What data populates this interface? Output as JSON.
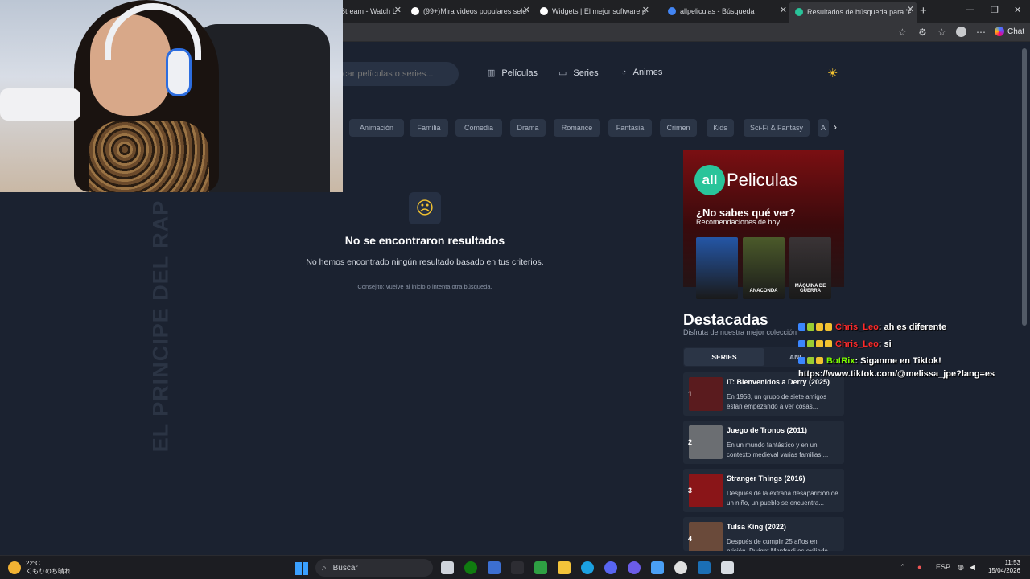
{
  "browser": {
    "tabs": [
      {
        "title": "Stream - Watch L",
        "favicon_color": "#9146ff",
        "active": false
      },
      {
        "title": "(99+)Mira videos populares selecc",
        "favicon_color": "#ffffff",
        "active": false
      },
      {
        "title": "Widgets | El mejor software para g",
        "favicon_color": "#ffffff",
        "active": false
      },
      {
        "title": "allpeliculas - Búsqueda",
        "favicon_color": "#4285f4",
        "active": false
      },
      {
        "title": "Resultados de búsqueda para \"el p",
        "favicon_color": "#29c49a",
        "active": true
      }
    ],
    "chat_label": "Chat"
  },
  "header": {
    "search_placeholder": "car películas o series...",
    "nav": [
      {
        "label": "Películas",
        "icon": "film-icon"
      },
      {
        "label": "Series",
        "icon": "tv-icon"
      },
      {
        "label": "Animes",
        "icon": "flame-icon"
      }
    ],
    "theme_icon": "sun-icon"
  },
  "genres": [
    "Animación",
    "Familia",
    "Comedia",
    "Drama",
    "Romance",
    "Fantasia",
    "Crimen",
    "Kids",
    "Sci-Fi & Fantasy",
    "A"
  ],
  "empty_state": {
    "icon": "sad-face-icon",
    "title": "No se encontraron resultados",
    "subtitle": "No hemos encontrado ningún resultado basado en tus criterios.",
    "tip": "Consejito: vuelve al inicio o intenta otra búsqueda."
  },
  "banner": {
    "logo_all": "all",
    "logo_name": "Peliculas",
    "question": "¿No sabes qué ver?",
    "subtitle": "Recomendaciones de hoy",
    "posters": [
      {
        "label": "",
        "color": "#2456a6"
      },
      {
        "label": "ANACONDA",
        "color": "#4b5a2a"
      },
      {
        "label": "MÁQUINA DE GUERRA",
        "color": "#3a3436"
      }
    ]
  },
  "destacadas": {
    "title": "Destacadas",
    "subtitle": "Disfruta de nuestra mejor colección",
    "tabs": [
      "SERIES",
      "ANI"
    ],
    "items": [
      {
        "rank": "1",
        "title": "IT: Bienvenidos a Derry (2025)",
        "desc": "En 1958, un grupo de siete amigos están empezando a ver cosas...",
        "color": "#5a1b1e"
      },
      {
        "rank": "2",
        "title": "Juego de Tronos (2011)",
        "desc": "En un mundo fantástico y en un contexto medieval varias familias,...",
        "color": "#6b6e72"
      },
      {
        "rank": "3",
        "title": "Stranger Things (2016)",
        "desc": "Después de la extraña desaparición de un niño, un pueblo se encuentra...",
        "color": "#8a1518"
      },
      {
        "rank": "4",
        "title": "Tulsa King (2022)",
        "desc": "Después de cumplir 25 años en prisión, Dwight Manfredi es exiliado...",
        "color": "#6a4a3a"
      }
    ]
  },
  "watermark": "EL PRINCIPE DEL RAP",
  "chat_overlay": [
    {
      "user": "Chris_Leo",
      "user_color": "#ff2a2a",
      "message": ": ah es diferente"
    },
    {
      "user": "Chris_Leo",
      "user_color": "#ff2a2a",
      "message": ": si"
    },
    {
      "user": "BotRix",
      "user_color": "#7cfc00",
      "message": ": Siganme en Tiktok!"
    }
  ],
  "chat_url": "https://www.tiktok.com/@melissa_jpe?lang=es",
  "taskbar": {
    "weather_temp": "22°C",
    "weather_desc": "くもりのち晴れ",
    "weather_badge": "1",
    "search_label": "Buscar",
    "lang": "ESP",
    "time": "11:53",
    "date": "15/04/2026"
  }
}
